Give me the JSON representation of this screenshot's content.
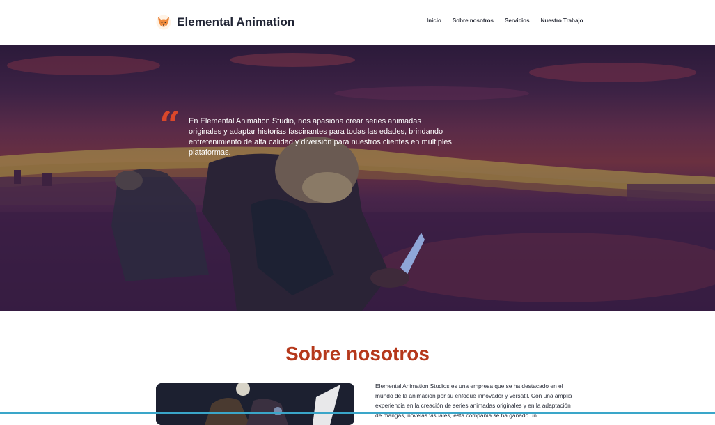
{
  "header": {
    "brand_name": "Elemental Animation",
    "logo_icon": "fox-logo-icon",
    "nav": [
      {
        "label": "Inicio",
        "active": true
      },
      {
        "label": "Sobre nosotros",
        "active": false
      },
      {
        "label": "Servicios",
        "active": false
      },
      {
        "label": "Nuestro Trabajo",
        "active": false
      }
    ]
  },
  "hero": {
    "quote_mark": "“",
    "quote_text": "En Elemental Animation Studio, nos apasiona crear series animadas originales y adaptar historias fascinantes para todas las edades, brindando entretenimiento de alta calidad y diversión para nuestros clientes en múltiples plataformas."
  },
  "about": {
    "title": "Sobre nosotros",
    "text": "Elemental Animation Studios es una empresa que se ha destacado en el mundo de la animación por su enfoque innovador y versátil. Con una amplia experiencia en la creación de series animadas originales y en la adaptación de mangas, novelas visuales, esta compañía se ha ganado un"
  },
  "colors": {
    "accent": "#b5381b",
    "quote": "#d9472b",
    "bottom_bar": "#3aa6c9"
  }
}
